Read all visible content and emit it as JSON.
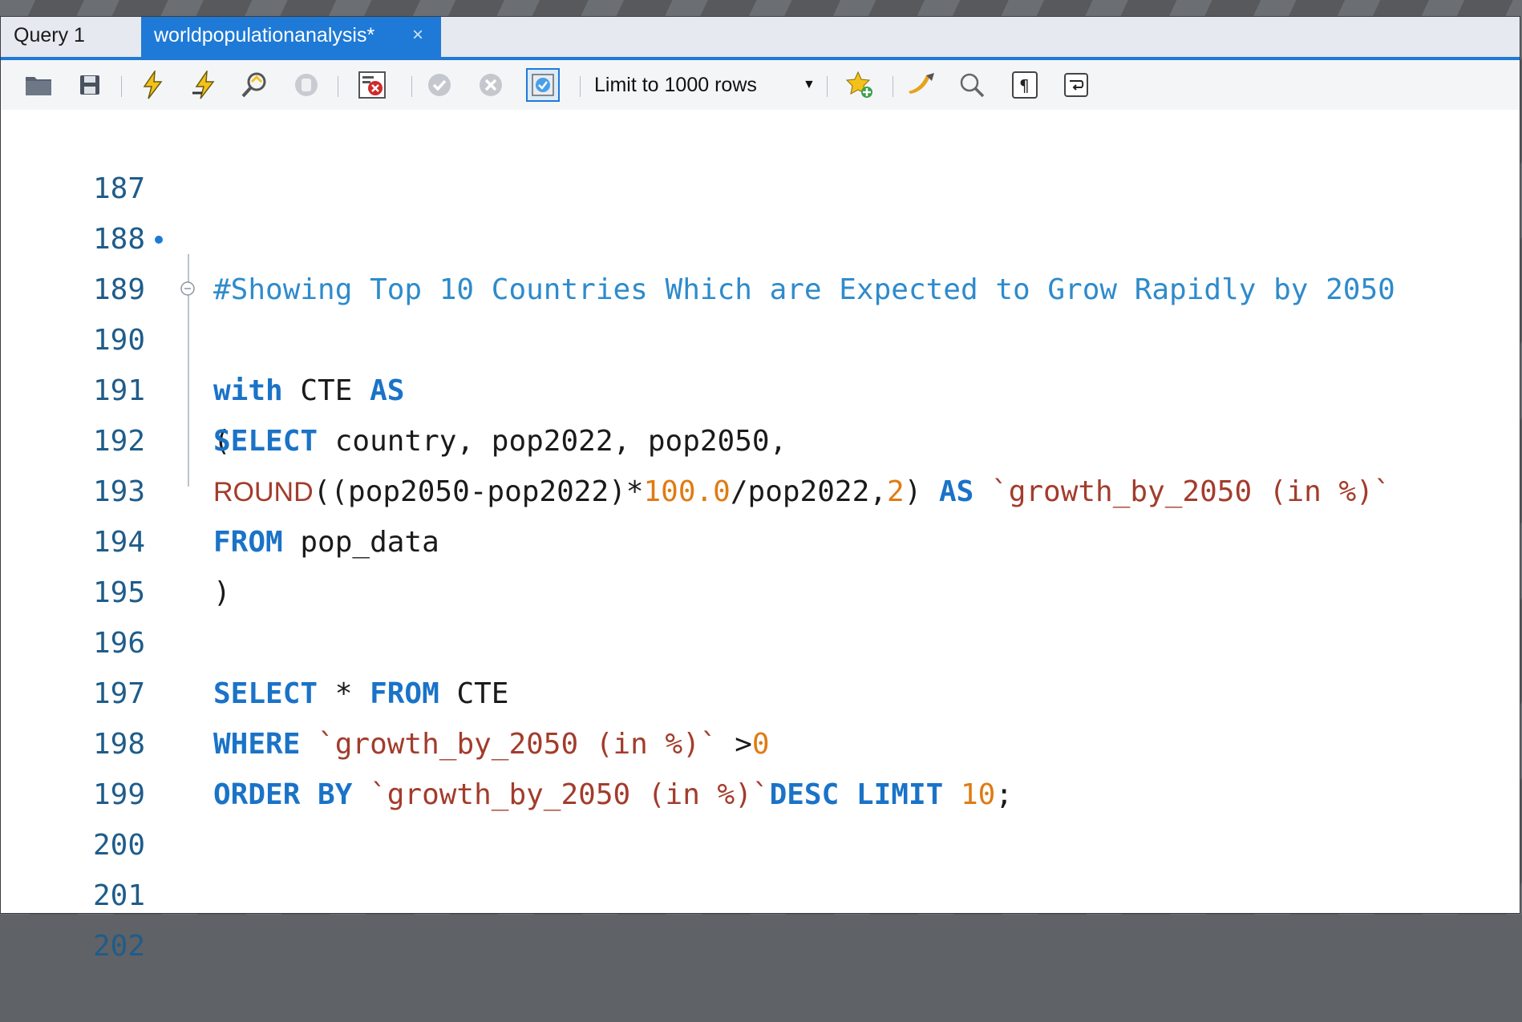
{
  "tabs": [
    {
      "label": "Query 1"
    },
    {
      "label": "worldpopulationanalysis*",
      "close": "×"
    }
  ],
  "toolbar": {
    "limit_label": "Limit to 1000 rows",
    "icons": [
      "folder-open-icon",
      "save-icon",
      "execute-icon",
      "execute-current-icon",
      "explain-icon",
      "stop-icon",
      "toggle-error-icon",
      "commit-icon",
      "rollback-icon",
      "autocommit-icon",
      "snippet-add-icon",
      "beautify-icon",
      "find-icon",
      "invisible-chars-icon",
      "word-wrap-icon"
    ]
  },
  "editor": {
    "lines": [
      {
        "n": "187"
      },
      {
        "n": "188"
      },
      {
        "n": "189"
      },
      {
        "n": "190"
      },
      {
        "n": "191"
      },
      {
        "n": "192"
      },
      {
        "n": "193"
      },
      {
        "n": "194"
      },
      {
        "n": "195"
      },
      {
        "n": "196"
      },
      {
        "n": "197"
      },
      {
        "n": "198"
      },
      {
        "n": "199"
      },
      {
        "n": "200"
      },
      {
        "n": "201"
      },
      {
        "n": "202"
      }
    ],
    "code": {
      "l188": "#Showing Top 10 Countries Which are Expected to Grow Rapidly by 2050",
      "l189_kw1": "with",
      "l189_mid": " CTE ",
      "l189_kw2": "AS",
      "l190": "(",
      "l191_kw": "SELECT",
      "l191_rest": " country, pop2022, pop2050,",
      "l192_fn": "ROUND",
      "l192_a": "((pop2050-pop2022)*",
      "l192_n1": "100.0",
      "l192_b": "/pop2022,",
      "l192_n2": "2",
      "l192_c": ") ",
      "l192_kw": "AS",
      "l192_str": " `growth_by_2050 (in %)`",
      "l193_kw": "FROM",
      "l193_rest": " pop_data",
      "l194": ")",
      "l196_kw1": "SELECT",
      "l196_mid": " * ",
      "l196_kw2": "FROM",
      "l196_rest": " CTE",
      "l197_kw": "WHERE",
      "l197_str": " `growth_by_2050 (in %)`",
      "l197_op": " >",
      "l197_num": "0",
      "l198_kw1": "ORDER BY",
      "l198_str": " `growth_by_2050 (in %)`",
      "l198_kw2": "DESC LIMIT",
      "l198_sp": " ",
      "l198_num": "10",
      "l198_end": ";"
    }
  }
}
